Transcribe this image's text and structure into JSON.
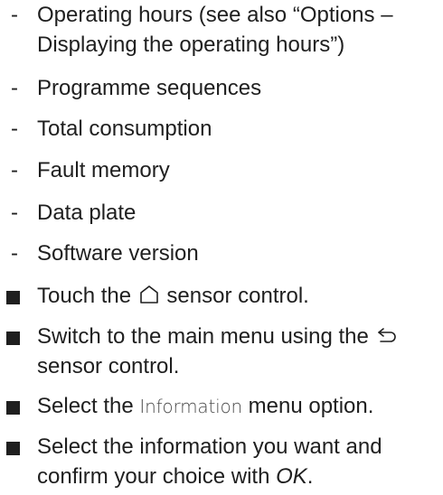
{
  "info_items": [
    {
      "line1": "Operating hours (see also “Options –",
      "line2": "Displaying the operating hours”)"
    },
    {
      "line1": "Programme sequences"
    },
    {
      "line1": "Total consumption"
    },
    {
      "line1": "Fault memory"
    },
    {
      "line1": "Data plate"
    },
    {
      "line1": "Software version"
    }
  ],
  "steps": {
    "step1": {
      "before": "Touch the",
      "icon": "home-icon",
      "after": "sensor control."
    },
    "step2": {
      "before": "Switch to the main menu using the",
      "icon": "back-arrow-icon",
      "line2": "sensor control."
    },
    "step3": {
      "before": "Select the",
      "ui_label": "Information",
      "after": "menu option."
    },
    "step4": {
      "line1": "Select the information you want and",
      "line2_before": "confirm your choice with",
      "line2_italic": "OK",
      "line2_after": "."
    }
  },
  "colors": {
    "text": "#1f1f1f",
    "ui_label": "#4a4a4a"
  }
}
